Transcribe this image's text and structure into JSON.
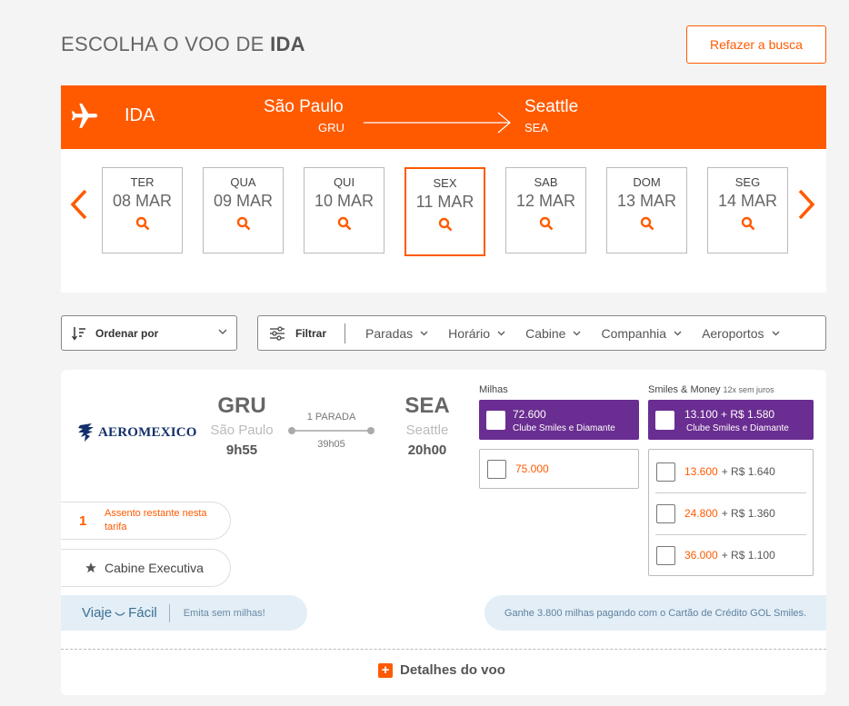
{
  "header": {
    "title_prefix": "ESCOLHA O VOO DE",
    "title_bold": "IDA",
    "refazer_label": "Refazer a busca"
  },
  "route": {
    "leg_label": "IDA",
    "from_city": "São Paulo",
    "from_code": "GRU",
    "to_city": "Seattle",
    "to_code": "SEA"
  },
  "dates": [
    {
      "dow": "TER",
      "dm": "08 MAR"
    },
    {
      "dow": "QUA",
      "dm": "09 MAR"
    },
    {
      "dow": "QUI",
      "dm": "10 MAR"
    },
    {
      "dow": "SEX",
      "dm": "11 MAR"
    },
    {
      "dow": "SAB",
      "dm": "12 MAR"
    },
    {
      "dow": "DOM",
      "dm": "13 MAR"
    },
    {
      "dow": "SEG",
      "dm": "14 MAR"
    }
  ],
  "toolbar": {
    "sort_label": "Ordenar por",
    "filter_label": "Filtrar",
    "filters": [
      "Paradas",
      "Horário",
      "Cabine",
      "Companhia",
      "Aeroportos"
    ]
  },
  "flight": {
    "airline": "AEROMEXICO",
    "origin_code": "GRU",
    "origin_city": "São Paulo",
    "departure": "9h55",
    "stops": "1 PARADA",
    "duration": "39h05",
    "dest_code": "SEA",
    "dest_city": "Seattle",
    "arrival": "20h00",
    "seats_num": "1",
    "seats_text": "Assento restante nesta tarifa",
    "cabin": "Cabine Executiva",
    "viaje_a": "Viaje",
    "viaje_b": "Fácil",
    "emita": "Emita sem milhas!",
    "ganhe": "Ganhe 3.800 milhas pagando com o Cartão de Crédito GOL Smiles.",
    "details": "Detalhes do voo"
  },
  "fares": {
    "milhas_head": "Milhas",
    "sm_head": "Smiles & Money",
    "sm_head_note": "12x sem juros",
    "milhas_club_amount": "72.600",
    "club_label": "Clube Smiles e Diamante",
    "milhas_regular": "75.000",
    "sm_club_amount": "13.100 + R$ 1.580",
    "sm_options": [
      {
        "miles": "13.600",
        "money": "+ R$ 1.640"
      },
      {
        "miles": "24.800",
        "money": "+ R$ 1.360"
      },
      {
        "miles": "36.000",
        "money": "+ R$ 1.100"
      }
    ]
  },
  "colors": {
    "accent": "#ff5a00",
    "club_purple": "#6a2d91"
  }
}
